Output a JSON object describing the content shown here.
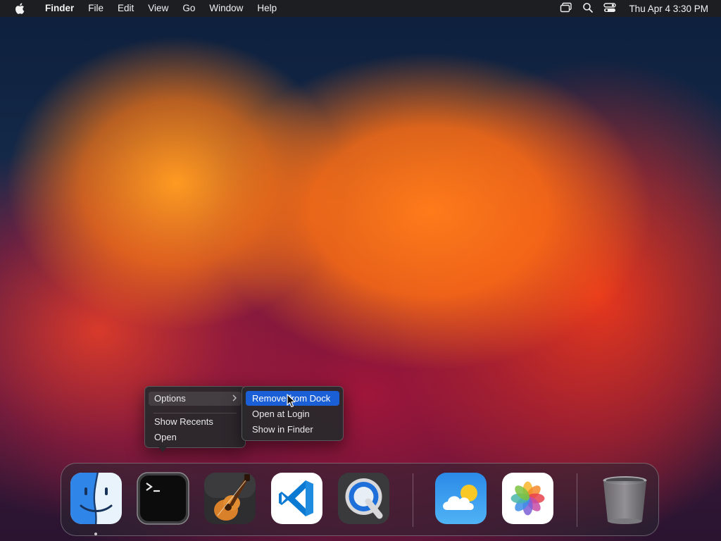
{
  "menubar": {
    "app_name": "Finder",
    "items": [
      "File",
      "Edit",
      "View",
      "Go",
      "Window",
      "Help"
    ],
    "clock": "Thu Apr 4  3:30 PM",
    "status_icons": [
      "screen-mirroring-icon",
      "spotlight-search-icon",
      "control-center-icon"
    ]
  },
  "context_menu": {
    "items": [
      {
        "label": "Options",
        "has_submenu": true,
        "highlighted": true
      },
      {
        "label": "Show Recents"
      },
      {
        "label": "Open"
      }
    ],
    "submenu": {
      "items": [
        {
          "label": "Remove from Dock",
          "selected": true
        },
        {
          "label": "Open at Login"
        },
        {
          "label": "Show in Finder"
        }
      ]
    }
  },
  "dock": {
    "apps": [
      {
        "name": "Finder",
        "icon": "finder-icon",
        "running": true
      },
      {
        "name": "Terminal",
        "icon": "terminal-icon",
        "running": false
      },
      {
        "name": "GarageBand",
        "icon": "garageband-icon",
        "running": false
      },
      {
        "name": "Visual Studio Code",
        "icon": "vscode-icon",
        "running": false
      },
      {
        "name": "QuickTime Player",
        "icon": "quicktime-icon",
        "running": false
      }
    ],
    "recent_apps": [
      {
        "name": "Weather",
        "icon": "weather-icon"
      },
      {
        "name": "Photos",
        "icon": "photos-icon"
      }
    ],
    "trash": {
      "name": "Trash",
      "icon": "trash-icon"
    }
  },
  "colors": {
    "menu_selection": "#1a5fd6",
    "menubar_bg": "#1e1e20",
    "vscode_blue": "#0a7ad3"
  }
}
